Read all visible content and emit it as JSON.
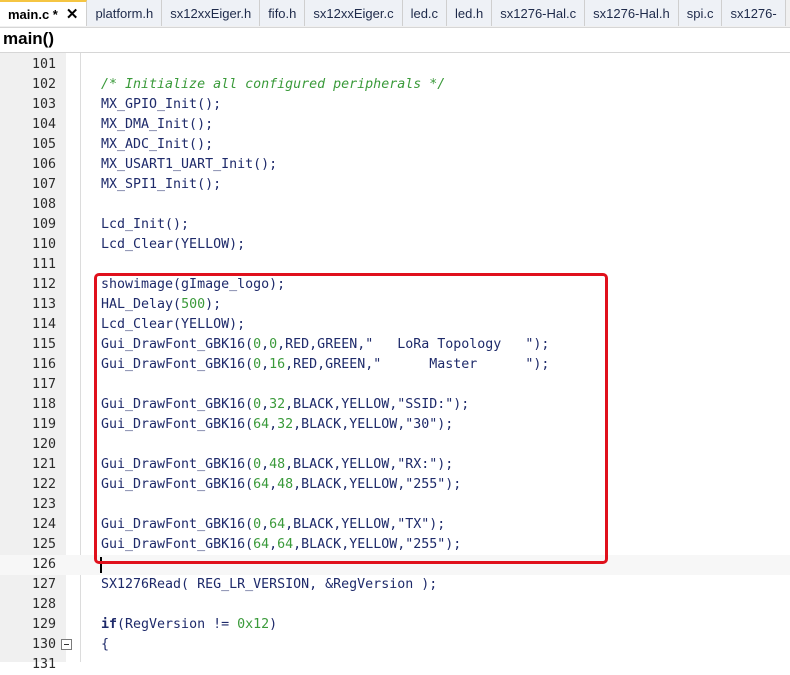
{
  "tabs": [
    {
      "label": "main.c *",
      "active": true
    },
    {
      "label": "platform.h"
    },
    {
      "label": "sx12xxEiger.h"
    },
    {
      "label": "fifo.h"
    },
    {
      "label": "sx12xxEiger.c"
    },
    {
      "label": "led.c"
    },
    {
      "label": "led.h"
    },
    {
      "label": "sx1276-Hal.c"
    },
    {
      "label": "sx1276-Hal.h"
    },
    {
      "label": "spi.c"
    },
    {
      "label": "sx1276-"
    }
  ],
  "tab_close_glyph": "✕",
  "function_name": "main()",
  "lines": [
    {
      "n": "101",
      "code": ""
    },
    {
      "n": "102",
      "code": "/* Initialize all configured peripherals */"
    },
    {
      "n": "103",
      "code": "MX_GPIO_Init();"
    },
    {
      "n": "104",
      "code": "MX_DMA_Init();"
    },
    {
      "n": "105",
      "code": "MX_ADC_Init();"
    },
    {
      "n": "106",
      "code": "MX_USART1_UART_Init();"
    },
    {
      "n": "107",
      "code": "MX_SPI1_Init();"
    },
    {
      "n": "108",
      "code": ""
    },
    {
      "n": "109",
      "code": "Lcd_Init();"
    },
    {
      "n": "110",
      "code": "Lcd_Clear(YELLOW);"
    },
    {
      "n": "111",
      "code": ""
    },
    {
      "n": "112",
      "code": "showimage(gImage_logo);"
    },
    {
      "n": "113",
      "code": "HAL_Delay(500);"
    },
    {
      "n": "114",
      "code": "Lcd_Clear(YELLOW);"
    },
    {
      "n": "115",
      "code": "Gui_DrawFont_GBK16(0,0,RED,GREEN,\"   LoRa Topology   \");"
    },
    {
      "n": "116",
      "code": "Gui_DrawFont_GBK16(0,16,RED,GREEN,\"      Master      \");"
    },
    {
      "n": "117",
      "code": ""
    },
    {
      "n": "118",
      "code": "Gui_DrawFont_GBK16(0,32,BLACK,YELLOW,\"SSID:\");"
    },
    {
      "n": "119",
      "code": "Gui_DrawFont_GBK16(64,32,BLACK,YELLOW,\"30\");"
    },
    {
      "n": "120",
      "code": ""
    },
    {
      "n": "121",
      "code": "Gui_DrawFont_GBK16(0,48,BLACK,YELLOW,\"RX:\");"
    },
    {
      "n": "122",
      "code": "Gui_DrawFont_GBK16(64,48,BLACK,YELLOW,\"255\");"
    },
    {
      "n": "123",
      "code": ""
    },
    {
      "n": "124",
      "code": "Gui_DrawFont_GBK16(0,64,BLACK,YELLOW,\"TX\");"
    },
    {
      "n": "125",
      "code": "Gui_DrawFont_GBK16(64,64,BLACK,YELLOW,\"255\");"
    },
    {
      "n": "126",
      "code": "",
      "current": true
    },
    {
      "n": "127",
      "code": "SX1276Read( REG_LR_VERSION, &RegVersion );"
    },
    {
      "n": "128",
      "code": ""
    },
    {
      "n": "129",
      "code": "if(RegVersion != 0x12)"
    },
    {
      "n": "130",
      "code": "{",
      "fold": true
    },
    {
      "n": "131",
      "code": ""
    }
  ],
  "colors": {
    "highlight_border": "#e0101c",
    "comment": "#3a9a3a",
    "number": "#3a9a3a",
    "code": "#1e2a6a",
    "active_tab_accent": "#f5c542"
  }
}
